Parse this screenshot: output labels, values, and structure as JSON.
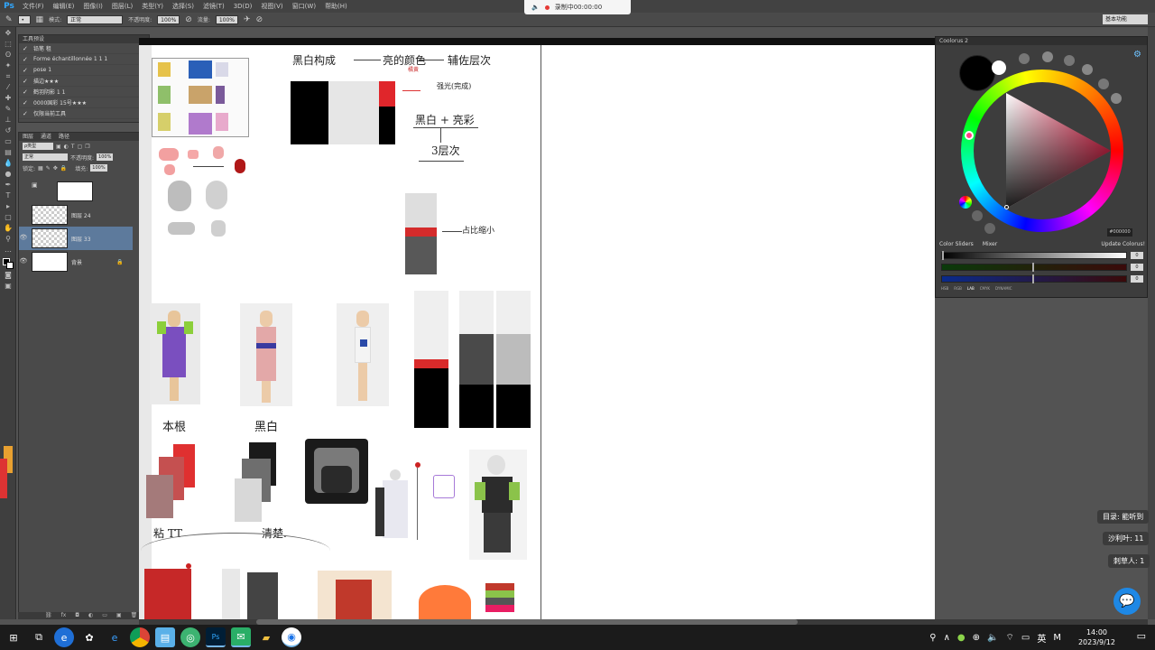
{
  "app": {
    "logo": "Ps",
    "menu": [
      "文件(F)",
      "编辑(E)",
      "图像(I)",
      "图层(L)",
      "类型(Y)",
      "选择(S)",
      "滤镜(T)",
      "3D(D)",
      "视图(V)",
      "窗口(W)",
      "帮助(H)"
    ],
    "options": {
      "mode_label": "模式:",
      "mode_value": "正常",
      "opacity_label": "不透明度:",
      "opacity_value": "100%",
      "flow_label": "流量:",
      "flow_value": "100%"
    },
    "workspace": "基本功能"
  },
  "recorder": {
    "text": "录制中00:00:00"
  },
  "history": {
    "tab": "工具预设",
    "items": [
      "铅笔 租",
      "Forme échantillonnée 1 1 1",
      "pose 1",
      "描边★★★",
      "鹤羽阴影 1 1",
      "0000国彩 15号★★★",
      "仅限当前工具"
    ]
  },
  "layers": {
    "tabs": [
      "图层",
      "通道",
      "路径"
    ],
    "kind_label": "ρ类型",
    "blend_value": "正常",
    "opacity_label": "不透明度:",
    "opacity_value": "100%",
    "lock_label": "锁定:",
    "fill_label": "填充:",
    "fill_value": "100%",
    "items": [
      {
        "name": "",
        "thumb": "white"
      },
      {
        "name": "图层 24",
        "thumb": "check"
      },
      {
        "name": "图层 33",
        "thumb": "check"
      },
      {
        "name": "背景",
        "thumb": "white"
      }
    ]
  },
  "canvas": {
    "notes": {
      "top_flow_1": "黑白构成",
      "top_flow_2": "亮的颜色",
      "top_flow_3": "橘黄",
      "top_flow_4": "辅佐层次",
      "small_note": "强光(完成)",
      "bw_color": "黑白 + 亮彩",
      "three_levels": "3层次",
      "small_area": "占比缩小",
      "label_left": "本根",
      "label_mid": "黑白",
      "label_bottom_left": "粘 TT",
      "label_bottom_mid": "清楚."
    }
  },
  "colorizer": {
    "title": "Coolorus 2",
    "hex_value": "#000000",
    "tabs": [
      "Color Sliders",
      "Mixer"
    ],
    "update_label": "Update Colorus!",
    "slider_values": [
      "0",
      "0",
      "0"
    ],
    "modes": [
      "HSB",
      "RGB",
      "LAB",
      "CMYK",
      "DYNAMIC"
    ],
    "current_color": "#000000",
    "previous_color": "#ffffff"
  },
  "chat": {
    "messages": [
      "目录: 能听到",
      "沙利叶: 11",
      "刺草人: 1"
    ]
  },
  "taskbar": {
    "clock_time": "14:00",
    "clock_date": "2023/9/12",
    "ime": "英",
    "ime_mode": "M"
  }
}
